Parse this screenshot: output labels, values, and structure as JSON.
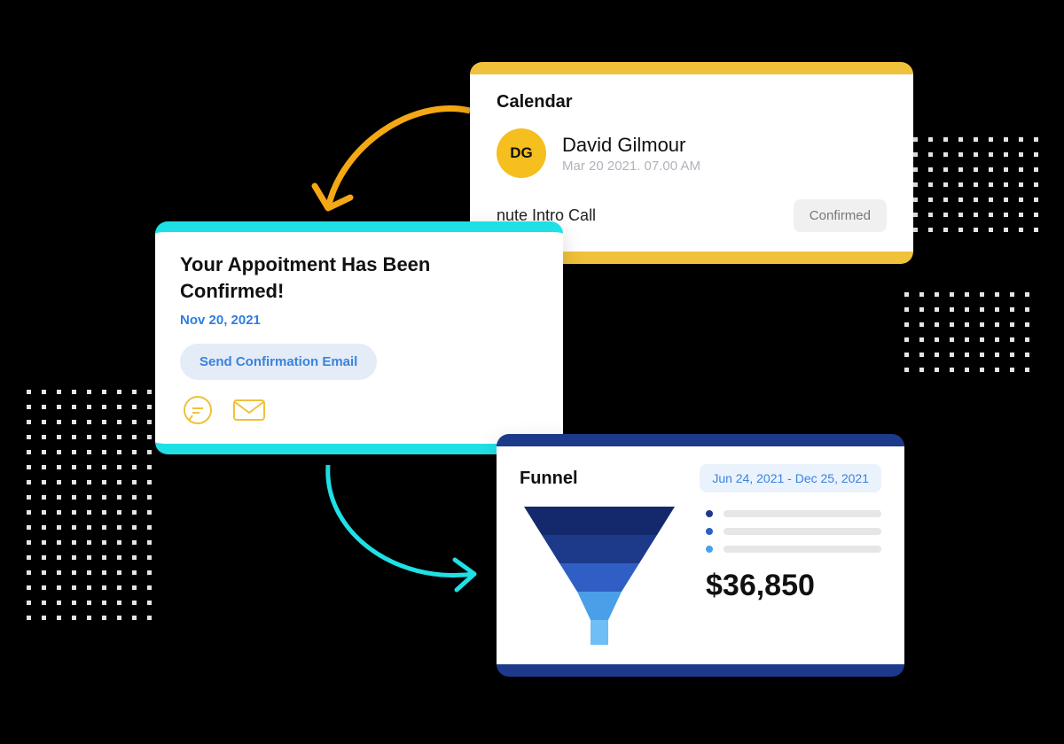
{
  "calendar": {
    "title": "Calendar",
    "initials": "DG",
    "name": "David Gilmour",
    "datetime": "Mar 20 2021. 07.00 AM",
    "event_title": "nute Intro Call",
    "status": "Confirmed"
  },
  "appointment": {
    "heading": "Your Appoitment Has Been Confirmed!",
    "date": "Nov 20, 2021",
    "button": "Send Confirmation Email"
  },
  "funnel": {
    "title": "Funnel",
    "date_range": "Jun 24, 2021 -  Dec 25, 2021",
    "amount": "$36,850",
    "legend_colors": [
      "#1d3a8a",
      "#2f5fc4",
      "#4a9fe8"
    ]
  },
  "colors": {
    "yellow": "#f0c13b",
    "cyan": "#1fe0e5",
    "navy": "#1d3a8a",
    "blue": "#3b82e0"
  }
}
